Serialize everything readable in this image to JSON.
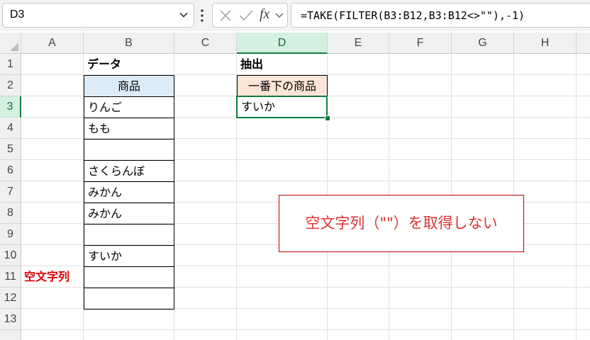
{
  "formula_bar": {
    "name_box": "D3",
    "fx_label": "fx",
    "formula": "=TAKE(FILTER(B3:B12,B3:B12<>\"\"),-1)"
  },
  "columns": [
    "A",
    "B",
    "C",
    "D",
    "E",
    "F",
    "G",
    "H"
  ],
  "selected_column": "D",
  "rows": [
    "1",
    "2",
    "3",
    "4",
    "5",
    "6",
    "7",
    "8",
    "9",
    "10",
    "11",
    "12",
    "13"
  ],
  "selected_row": "3",
  "cells": {
    "B1": "データ",
    "B2": "商品",
    "B3": "りんご",
    "B4": "もも",
    "B5": "",
    "B6": "さくらんぼ",
    "B7": "みかん",
    "B8": "みかん",
    "B9": "",
    "B10": "すいか",
    "B11": "",
    "B12": "",
    "D1": "抽出",
    "D2": "一番下の商品",
    "D3": "すいか",
    "A11": "空文字列"
  },
  "callout": {
    "text": "空文字列（\"\"）を取得しない"
  },
  "colors": {
    "selection": "#107c41",
    "header_blue": "#ddebf7",
    "header_orange": "#fce4d6",
    "annotation_red": "#e00000"
  }
}
